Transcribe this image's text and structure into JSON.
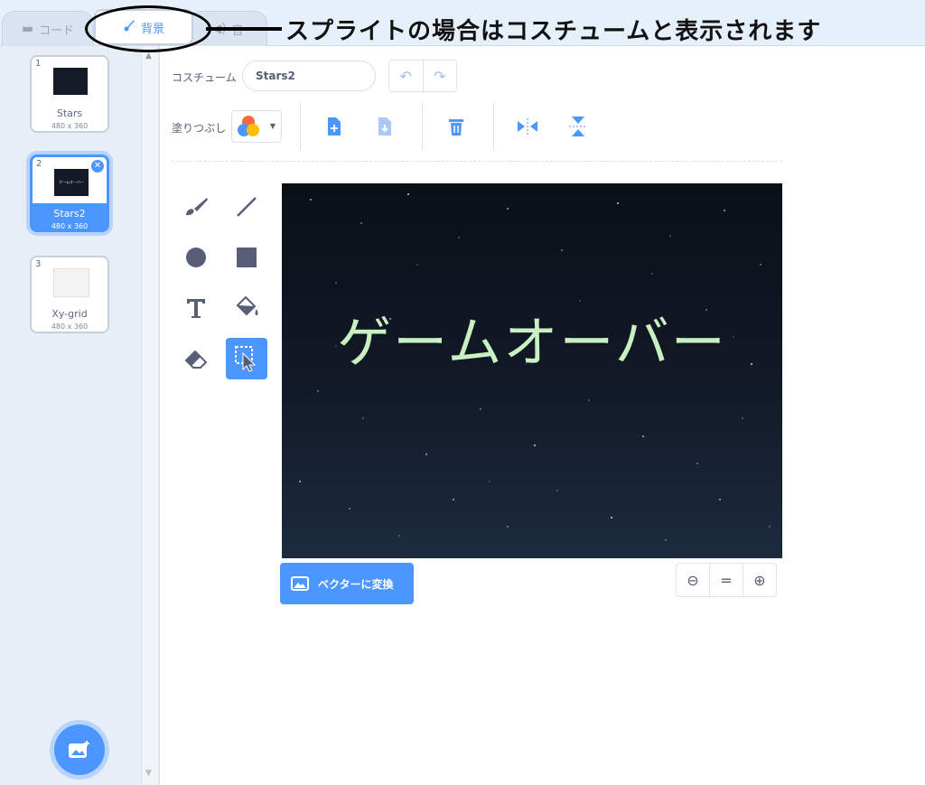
{
  "tabs": {
    "code": "コード",
    "costume": "背景",
    "sound": "音"
  },
  "annotation": "スプライトの場合はコスチュームと表示されます",
  "costumes": [
    {
      "index": "1",
      "name": "Stars",
      "size": "480 x 360"
    },
    {
      "index": "2",
      "name": "Stars2",
      "size": "480 x 360",
      "selected": true
    },
    {
      "index": "3",
      "name": "Xy-grid",
      "size": "480 x 360"
    }
  ],
  "editor": {
    "costume_label": "コスチューム",
    "costume_name": "Stars2",
    "fill_label": "塗りつぶし",
    "canvas_text": "ゲームオーバー",
    "convert_button": "ベクターに変換"
  },
  "colors": {
    "accent": "#4c97ff",
    "canvas_text": "#c9f0c0"
  }
}
